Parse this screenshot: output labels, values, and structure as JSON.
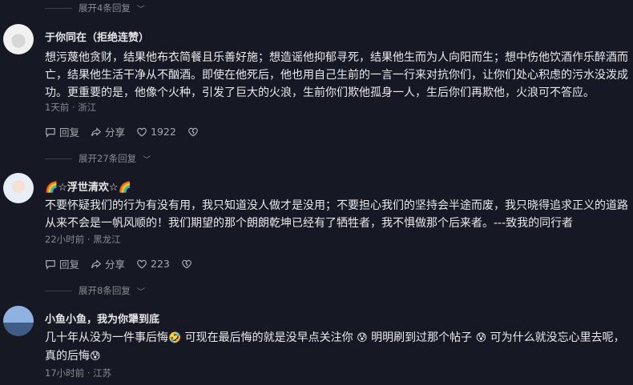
{
  "expand_top": "展开4条回复",
  "comments": [
    {
      "username": "于你同在（拒绝连赞）",
      "text": "想污蔑他贪财，结果他布衣简餐且乐善好施；想造谣他抑郁寻死，结果他生而为人向阳而生；想中伤他饮酒作乐醉酒而亡，结果他生活干净从不酗酒。即使在他死后，他也用自己生前的一言一行来对抗你们，让你们处心积虑的污水没泼成功。更重要的是，他像个火种，引发了巨大的火浪，生前你们欺他孤身一人，生后你们再欺他，火浪可不答应。",
      "meta": "1天前 · 浙江",
      "reply_label": "回复",
      "share_label": "分享",
      "likes": "1922",
      "expand": "展开27条回复"
    },
    {
      "username_prefix": "🌈",
      "username": "☆浮世清欢☆",
      "username_suffix": "🌈",
      "text": "不要怀疑我们的行为有没有用，我只知道没人做才是没用；不要担心我们的坚持会半途而废，我只晓得追求正义的道路从来不会是一帆风顺的！我们期望的那个朗朗乾坤已经有了牺牲者，我不惧做那个后来者。---致我的同行者",
      "meta": "22小时前 · 黑龙江",
      "reply_label": "回复",
      "share_label": "分享",
      "likes": "223",
      "expand": "展开8条回复"
    },
    {
      "username": "小鱼小鱼，我为你犟到底",
      "text_parts": [
        "几十年从没为一件事后悔",
        "🤣",
        " 可现在最后悔的就是没早点关注你 ",
        "😰",
        " 明明刷到过那个帖子 ",
        "😰",
        " 可为什么就没忘心里去呢，真的后悔",
        "😰"
      ],
      "meta": "17小时前 · 江苏"
    }
  ]
}
